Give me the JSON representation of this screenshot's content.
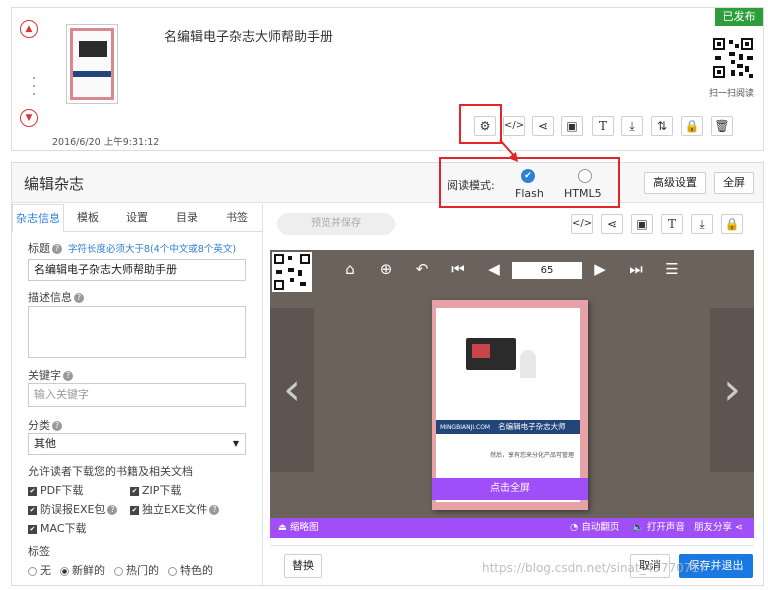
{
  "book": {
    "title": "名编辑电子杂志大师帮助手册",
    "date": "2016/6/20 上午9:31:12",
    "status": "已发布",
    "scan_label": "扫一扫阅读",
    "cover_brand": "MINGBIANJI.COM",
    "cover_title": "名编辑电子杂志大师",
    "cover_sub": "然后，享有您来分化产品可管理"
  },
  "toolbar_icons": [
    "gear-icon",
    "embed-code-icon",
    "share-icon",
    "book-icon",
    "text-icon",
    "download-icon",
    "sort-icon",
    "lock-icon",
    "trash-icon"
  ],
  "editor": {
    "title": "编辑杂志",
    "read_mode_label": "阅读模式:",
    "mode_flash": "Flash",
    "mode_html5": "HTML5",
    "advanced_label": "高级设置",
    "fullscreen_label": "全屏",
    "tabs": [
      "杂志信息",
      "模板",
      "设置",
      "目录",
      "书签"
    ],
    "preview_save": "预览并保存"
  },
  "form": {
    "title_label": "标题",
    "title_hint": "字符长度必须大于8(4个中文或8个英文)",
    "title_value": "名编辑电子杂志大师帮助手册",
    "desc_label": "描述信息",
    "keywords_label": "关键字",
    "keywords_placeholder": "输入关键字",
    "category_label": "分类",
    "category_value": "其他",
    "download_label": "允许读者下载您的书籍及相关文档",
    "download_options": [
      "PDF下载",
      "ZIP下载",
      "防误报EXE包",
      "独立EXE文件",
      "MAC下载"
    ],
    "tags_label": "标签",
    "tags_options": [
      "无",
      "新鲜的",
      "热门的",
      "特色的"
    ]
  },
  "viewer": {
    "page_number": "65",
    "fullscreen_hint": "点击全屏",
    "thumb_label": "缩略图",
    "autoflip": "自动翻页",
    "sound": "打开声音",
    "share": "朋友分享"
  },
  "footer": {
    "replace": "替换",
    "cancel": "取消",
    "save_exit": "保存并退出",
    "watermark": "https://blog.csdn.net/sinat_43770717"
  },
  "colors": {
    "accent_red": "#e0262a",
    "published_green": "#2e9d3b",
    "flash_blue": "#2f7fd5",
    "viewer_purple": "#9f4ef8",
    "save_blue": "#1a78e2"
  }
}
